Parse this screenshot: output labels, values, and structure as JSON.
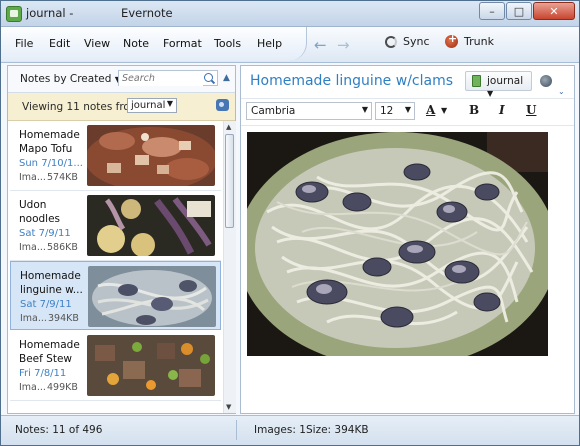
{
  "window": {
    "title": "journal - ",
    "app_name": "Evernote",
    "buttons": [
      "minimize",
      "maximize",
      "close"
    ]
  },
  "menu": {
    "items": [
      "File",
      "Edit",
      "View",
      "Note",
      "Format",
      "Tools",
      "Help"
    ],
    "sync_label": "Sync",
    "trunk_label": "Trunk"
  },
  "list": {
    "sort_label": "Notes by Created",
    "search_placeholder": "Search",
    "viewing_text": "Viewing 11 notes from",
    "notebook": "journal",
    "notes": [
      {
        "title": "Homemade Mapo Tofu",
        "date": "Sun 7/10/1...",
        "meta": "Ima...",
        "size": "574KB",
        "selected": false
      },
      {
        "title": "Udon noodles",
        "date": "Sat 7/9/11",
        "meta": "Ima...",
        "size": "586KB",
        "selected": false
      },
      {
        "title": "Homemade linguine w...",
        "date": "Sat 7/9/11",
        "meta": "Ima...",
        "size": "394KB",
        "selected": true
      },
      {
        "title": "Homemade Beef Stew",
        "date": "Fri 7/8/11",
        "meta": "Ima...",
        "size": "499KB",
        "selected": false
      }
    ]
  },
  "editor": {
    "note_title": "Homemade linguine w/clams",
    "notebook": "journal",
    "font": "Cambria",
    "font_size": "12",
    "format_buttons": {
      "text_color": "A",
      "bold": "B",
      "italic": "I",
      "underline": "U"
    }
  },
  "status": {
    "notes_count": "Notes: 11 of 496",
    "images": "Images: 1",
    "size": "Size: 394KB"
  },
  "colors": {
    "accent": "#2f7fc3",
    "selected_row": "#d6e6f7",
    "viewing_bar": "#f6efd2"
  }
}
